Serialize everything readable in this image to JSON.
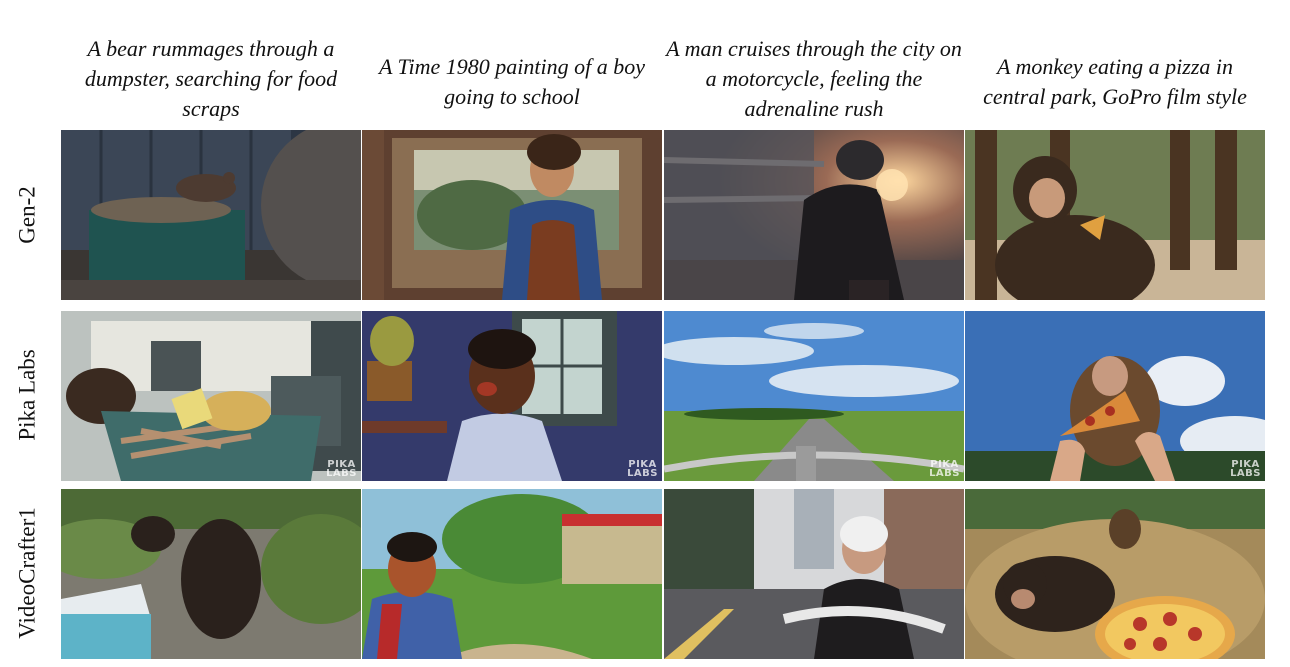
{
  "captions": [
    "A bear rummages through a dumpster, searching for food scraps",
    "A Time 1980 painting of a boy going to school",
    "A man cruises through the city on a motorcycle, feeling the adrenaline rush",
    "A monkey eating a pizza in central park, GoPro film style"
  ],
  "rows": [
    "Gen-2",
    "Pika Labs",
    "VideoCrafter1"
  ],
  "watermark": {
    "line1": "PIKA",
    "line2": "LABS"
  }
}
